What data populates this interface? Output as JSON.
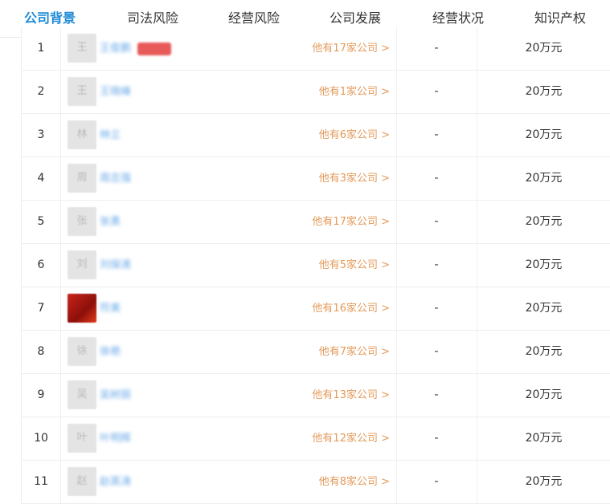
{
  "tabs": [
    {
      "label": "公司背景",
      "active": true
    },
    {
      "label": "司法风险",
      "active": false
    },
    {
      "label": "经营风险",
      "active": false
    },
    {
      "label": "公司发展",
      "active": false
    },
    {
      "label": "经营状况",
      "active": false
    },
    {
      "label": "知识产权",
      "active": false
    }
  ],
  "rows": [
    {
      "index": "1",
      "avatar_char": "王",
      "name": "王俊鹏",
      "companies": "他有17家公司 >",
      "value": "-",
      "amount": "20万元",
      "has_badge": true
    },
    {
      "index": "2",
      "avatar_char": "王",
      "name": "王晓峰",
      "companies": "他有1家公司 >",
      "value": "-",
      "amount": "20万元"
    },
    {
      "index": "3",
      "avatar_char": "林",
      "name": "林立",
      "companies": "他有6家公司 >",
      "value": "-",
      "amount": "20万元"
    },
    {
      "index": "4",
      "avatar_char": "周",
      "name": "周志强",
      "companies": "他有3家公司 >",
      "value": "-",
      "amount": "20万元"
    },
    {
      "index": "5",
      "avatar_char": "张",
      "name": "张勇",
      "companies": "他有17家公司 >",
      "value": "-",
      "amount": "20万元"
    },
    {
      "index": "6",
      "avatar_char": "刘",
      "name": "刘保清",
      "companies": "他有5家公司 >",
      "value": "-",
      "amount": "20万元"
    },
    {
      "index": "7",
      "avatar_char": "",
      "name": "符美",
      "companies": "他有16家公司 >",
      "value": "-",
      "amount": "20万元",
      "photo": true
    },
    {
      "index": "8",
      "avatar_char": "徐",
      "name": "徐艳",
      "companies": "他有7家公司 >",
      "value": "-",
      "amount": "20万元"
    },
    {
      "index": "9",
      "avatar_char": "吴",
      "name": "吴树丽",
      "companies": "他有13家公司 >",
      "value": "-",
      "amount": "20万元"
    },
    {
      "index": "10",
      "avatar_char": "叶",
      "name": "叶明辉",
      "companies": "他有12家公司 >",
      "value": "-",
      "amount": "20万元"
    },
    {
      "index": "11",
      "avatar_char": "赵",
      "name": "赵英涛",
      "companies": "他有8家公司 >",
      "value": "-",
      "amount": "20万元"
    }
  ],
  "colors": {
    "active_tab": "#1f8ad6",
    "link_orange": "#e39a5a",
    "name_blue": "#67a8e8",
    "badge_red": "#e8595a"
  }
}
